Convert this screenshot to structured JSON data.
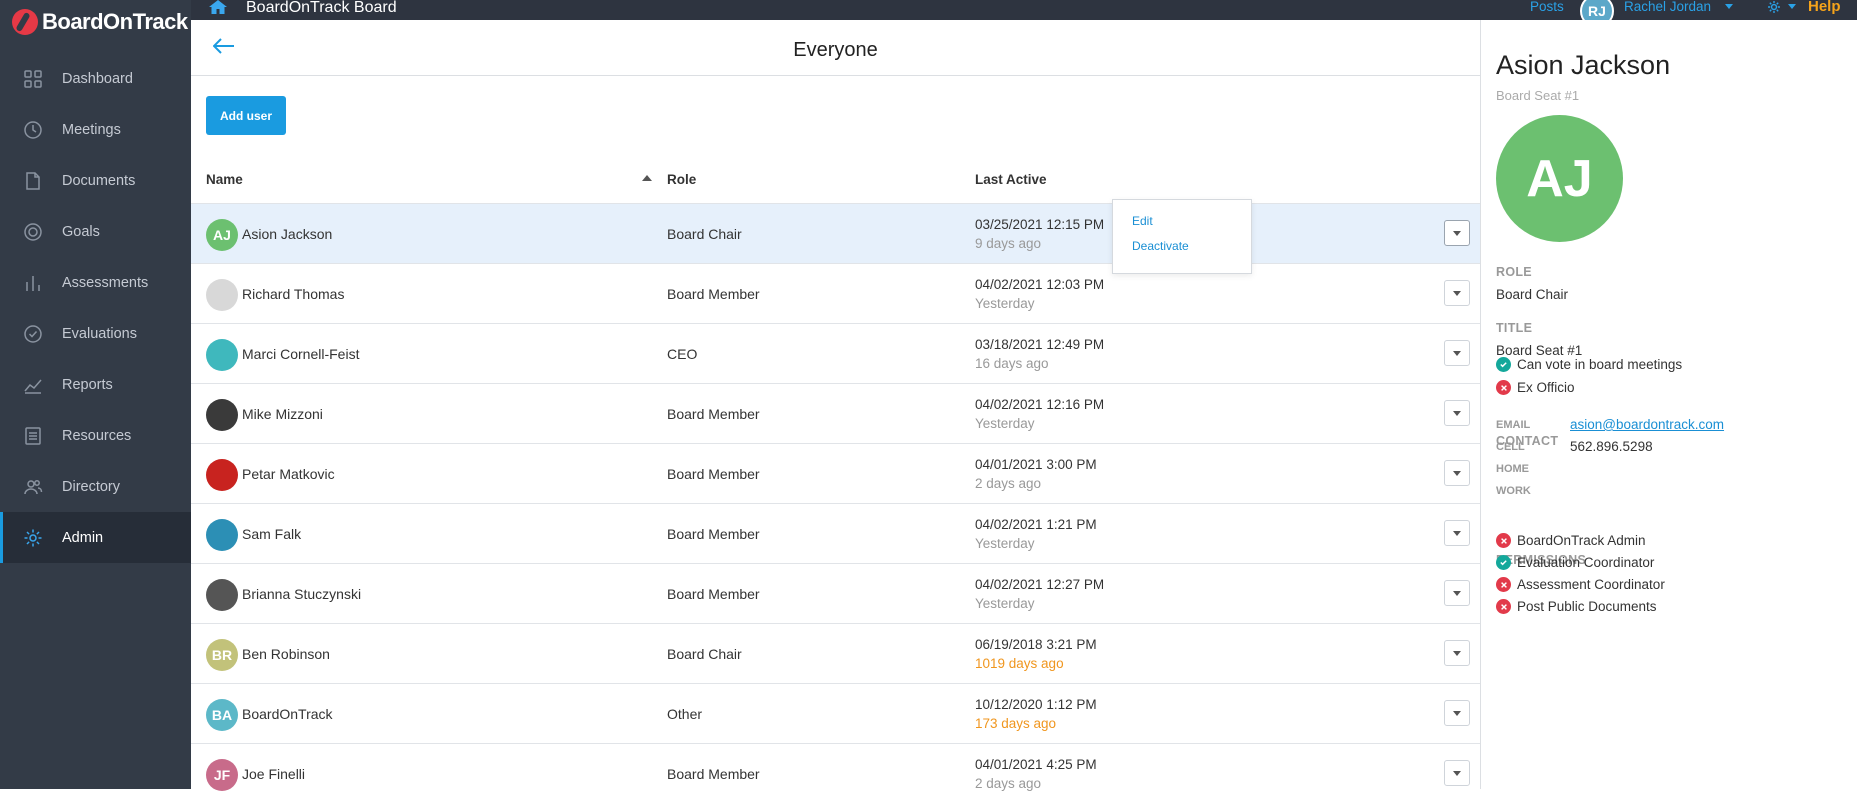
{
  "brand": {
    "name": "BoardOnTrack",
    "app_title": "BoardOnTrack Board"
  },
  "topbar": {
    "posts": "Posts",
    "user_initials": "RJ",
    "user_name": "Rachel Jordan",
    "help": "Help"
  },
  "sidebar": {
    "items": [
      {
        "label": "Dashboard",
        "icon": "grid-icon"
      },
      {
        "label": "Meetings",
        "icon": "clock-icon"
      },
      {
        "label": "Documents",
        "icon": "document-icon"
      },
      {
        "label": "Goals",
        "icon": "target-icon"
      },
      {
        "label": "Assessments",
        "icon": "bar-chart-icon"
      },
      {
        "label": "Evaluations",
        "icon": "check-circle-icon"
      },
      {
        "label": "Reports",
        "icon": "line-chart-icon"
      },
      {
        "label": "Resources",
        "icon": "list-icon"
      },
      {
        "label": "Directory",
        "icon": "people-icon"
      },
      {
        "label": "Admin",
        "icon": "gear-icon",
        "active": true
      }
    ]
  },
  "main": {
    "title": "Everyone",
    "add_user_label": "Add user",
    "columns": {
      "name": "Name",
      "role": "Role",
      "last_active": "Last Active"
    },
    "rows": [
      {
        "initials": "AJ",
        "name": "Asion Jackson",
        "role": "Board Chair",
        "date": "03/25/2021 12:15 PM",
        "ago": "9 days ago",
        "stale": false,
        "avatar_color": "#6cc070"
      },
      {
        "initials": "",
        "name": "Richard Thomas",
        "role": "Board Member",
        "date": "04/02/2021 12:03 PM",
        "ago": "Yesterday",
        "stale": false,
        "avatar_color": "#d8d8d8"
      },
      {
        "initials": "",
        "name": "Marci Cornell-Feist",
        "role": "CEO",
        "date": "03/18/2021 12:49 PM",
        "ago": "16 days ago",
        "stale": false,
        "avatar_color": "#3fb8bd"
      },
      {
        "initials": "",
        "name": "Mike Mizzoni",
        "role": "Board Member",
        "date": "04/02/2021 12:16 PM",
        "ago": "Yesterday",
        "stale": false,
        "avatar_color": "#3a3a3a"
      },
      {
        "initials": "",
        "name": "Petar Matkovic",
        "role": "Board Member",
        "date": "04/01/2021 3:00 PM",
        "ago": "2 days ago",
        "stale": false,
        "avatar_color": "#c8231f"
      },
      {
        "initials": "",
        "name": "Sam Falk",
        "role": "Board Member",
        "date": "04/02/2021 1:21 PM",
        "ago": "Yesterday",
        "stale": false,
        "avatar_color": "#2c8fb5"
      },
      {
        "initials": "",
        "name": "Brianna Stuczynski",
        "role": "Board Member",
        "date": "04/02/2021 12:27 PM",
        "ago": "Yesterday",
        "stale": false,
        "avatar_color": "#555555"
      },
      {
        "initials": "BR",
        "name": "Ben Robinson",
        "role": "Board Chair",
        "date": "06/19/2018 3:21 PM",
        "ago": "1019 days ago",
        "stale": true,
        "avatar_color": "#c2c27a"
      },
      {
        "initials": "BA",
        "name": "BoardOnTrack",
        "role": "Other",
        "date": "10/12/2020 1:12 PM",
        "ago": "173 days ago",
        "stale": true,
        "avatar_color": "#5cb8c8"
      },
      {
        "initials": "JF",
        "name": "Joe Finelli",
        "role": "Board Member",
        "date": "04/01/2021 4:25 PM",
        "ago": "2 days ago",
        "stale": false,
        "avatar_color": "#c86b8a"
      }
    ],
    "dropdown": {
      "edit": "Edit",
      "deactivate": "Deactivate"
    }
  },
  "panel": {
    "name": "Asion Jackson",
    "seat": "Board Seat #1",
    "initials": "AJ",
    "role_label": "ROLE",
    "role": "Board Chair",
    "title_label": "TITLE",
    "title": "Board Seat #1",
    "flags": [
      {
        "label": "Can vote in board meetings",
        "ok": true
      },
      {
        "label": "Ex Officio",
        "ok": false
      }
    ],
    "contact_label": "CONTACT",
    "contact": [
      {
        "key": "EMAIL",
        "value": "asion@boardontrack.com"
      },
      {
        "key": "CELL",
        "value": "562.896.5298"
      },
      {
        "key": "HOME",
        "value": ""
      },
      {
        "key": "WORK",
        "value": ""
      }
    ],
    "permissions_label": "PERMISSIONS",
    "permissions": [
      {
        "label": "BoardOnTrack Admin",
        "ok": false
      },
      {
        "label": "Evaluation Coordinator",
        "ok": true
      },
      {
        "label": "Assessment Coordinator",
        "ok": false
      },
      {
        "label": "Post Public Documents",
        "ok": false
      }
    ]
  }
}
